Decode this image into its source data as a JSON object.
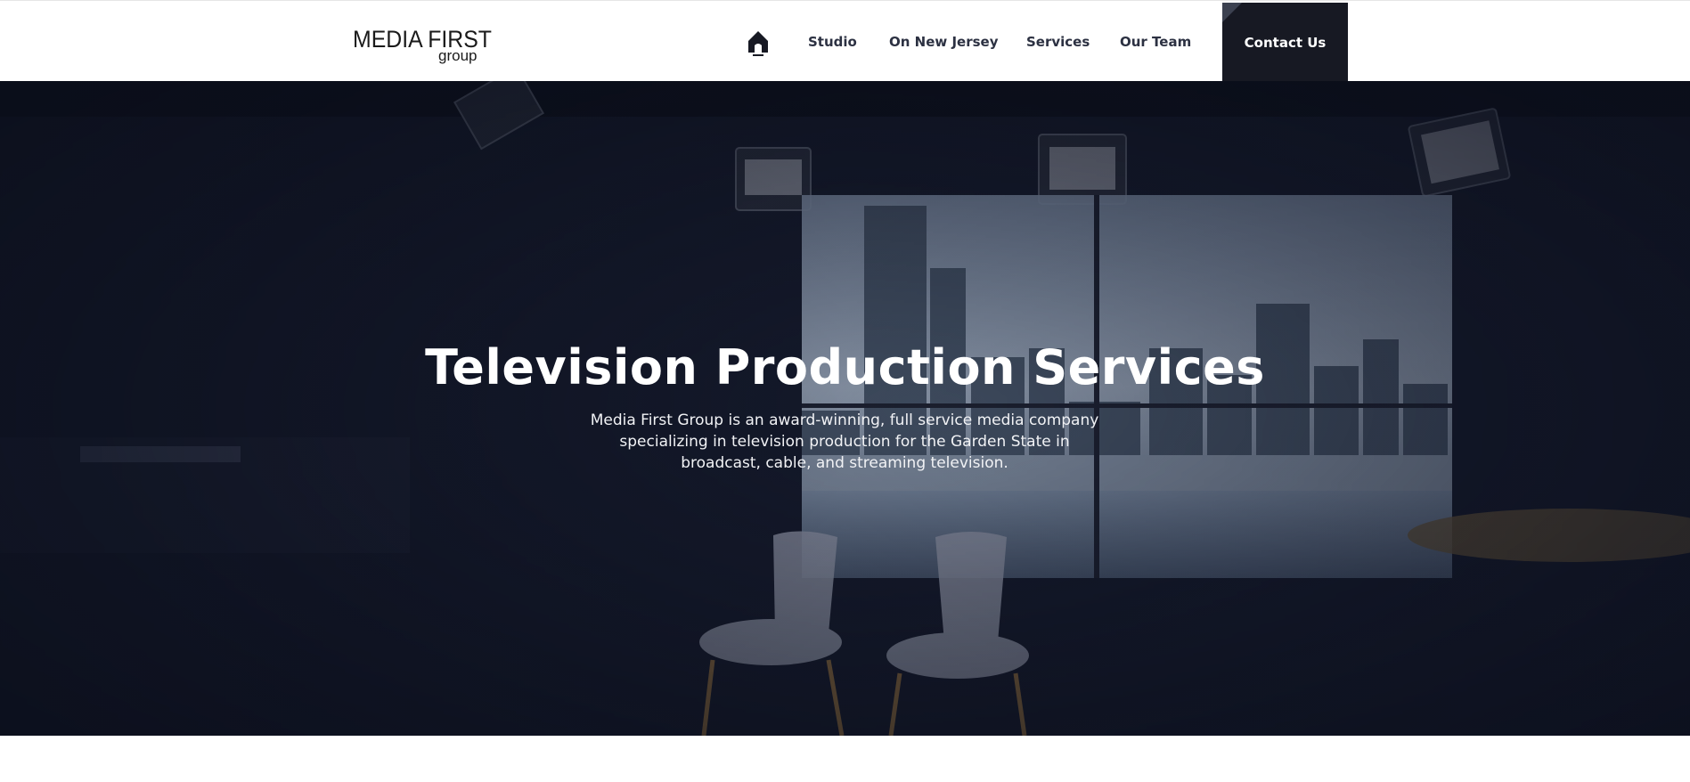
{
  "header": {
    "logo": {
      "main": "MEDIA FIRST",
      "sub": "group"
    },
    "nav": {
      "home_icon": "home-icon",
      "items": [
        "Studio",
        "On New Jersey",
        "Services",
        "Our Team"
      ],
      "contact_label": "Contact Us"
    }
  },
  "hero": {
    "title": "Television Production Services",
    "description": "Media First Group is an award-winning, full service media company specializing in television production for the Garden State in broadcast, cable, and streaming television."
  },
  "colors": {
    "nav_text": "#2c3142",
    "contact_bg": "#171923",
    "hero_tint": "#0e1220",
    "white": "#ffffff"
  }
}
